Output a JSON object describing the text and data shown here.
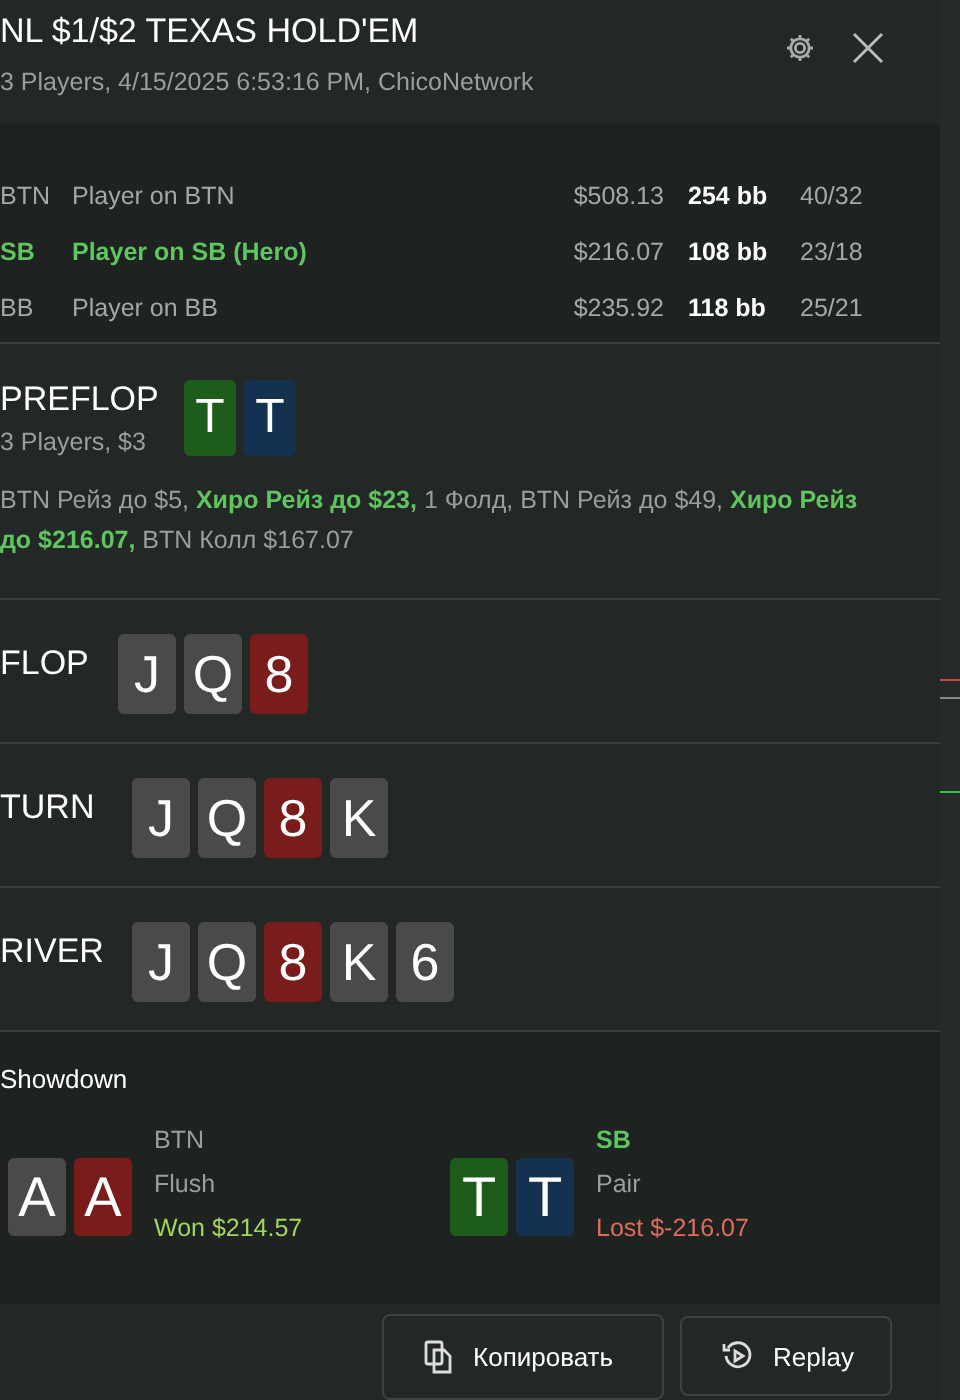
{
  "header": {
    "title": "NL $1/$2 TEXAS HOLD'EM",
    "subtitle": "3 Players, 4/15/2025 6:53:16 PM, ChicoNetwork"
  },
  "players": [
    {
      "position": "BTN",
      "name": "Player on BTN",
      "stack": "$508.13",
      "bb": "254 bb",
      "stats": "40/32",
      "hero": false
    },
    {
      "position": "SB",
      "name": "Player on SB (Hero)",
      "stack": "$216.07",
      "bb": "108 bb",
      "stats": "23/18",
      "hero": true
    },
    {
      "position": "BB",
      "name": "Player on BB",
      "stack": "$235.92",
      "bb": "118 bb",
      "stats": "25/21",
      "hero": false
    }
  ],
  "streets": [
    {
      "name": "PREFLOP",
      "info": "3 Players, $3",
      "cards": [
        {
          "rank": "T",
          "color": "#1d5c1a"
        },
        {
          "rank": "T",
          "color": "#143250"
        }
      ],
      "actions": "BTN Рейз до $5, **Хиро Рейз до $23,** 1 Фолд, BTN Рейз до $49, **Хиро Рейз до $216.07,** BTN Колл $167.07"
    },
    {
      "name": "FLOP",
      "cards": [
        {
          "rank": "J",
          "color": "#4a4a4a"
        },
        {
          "rank": "Q",
          "color": "#4a4a4a"
        },
        {
          "rank": "8",
          "color": "#7b1c1c"
        }
      ]
    },
    {
      "name": "TURN",
      "cards": [
        {
          "rank": "J",
          "color": "#4a4a4a"
        },
        {
          "rank": "Q",
          "color": "#4a4a4a"
        },
        {
          "rank": "8",
          "color": "#7b1c1c"
        },
        {
          "rank": "K",
          "color": "#4a4a4a"
        }
      ]
    },
    {
      "name": "RIVER",
      "cards": [
        {
          "rank": "J",
          "color": "#4a4a4a"
        },
        {
          "rank": "Q",
          "color": "#4a4a4a"
        },
        {
          "rank": "8",
          "color": "#7b1c1c"
        },
        {
          "rank": "K",
          "color": "#4a4a4a"
        },
        {
          "rank": "6",
          "color": "#4a4a4a"
        }
      ]
    }
  ],
  "showdown": {
    "title": "Showdown",
    "hands": [
      {
        "cards": [
          {
            "rank": "A",
            "color": "#4a4a4a"
          },
          {
            "rank": "A",
            "color": "#7b1c1c"
          }
        ],
        "position": "BTN",
        "hero": false,
        "hand": "Flush",
        "result": "Won $214.57",
        "won": true
      },
      {
        "cards": [
          {
            "rank": "T",
            "color": "#1d5c1a"
          },
          {
            "rank": "T",
            "color": "#143250"
          }
        ],
        "position": "SB",
        "hero": true,
        "hand": "Pair",
        "result": "Lost $-216.07",
        "won": false
      }
    ]
  },
  "buttons": [
    {
      "kind": "copy",
      "label": "Копировать"
    },
    {
      "kind": "replay",
      "label": "Replay"
    }
  ]
}
